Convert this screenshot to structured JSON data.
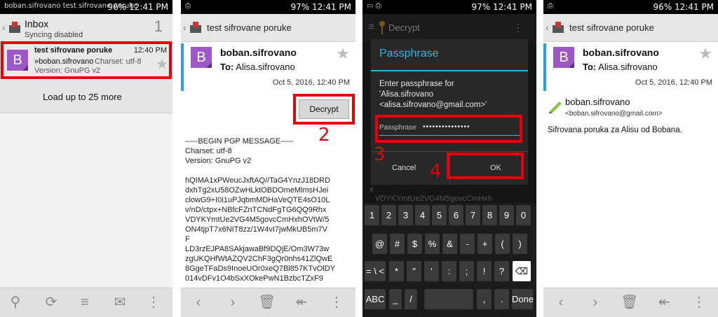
{
  "screen1": {
    "status_left": "boban.sifrovano test sifrovane poruke",
    "status_right": "96% 12:41 PM",
    "title": "Inbox",
    "subtitle": "Syncing disabled",
    "count": "1",
    "mail": {
      "avatar": "B",
      "subject": "test sifrovane poruke",
      "time": "12:40 PM",
      "from": "»boban.sifrovano",
      "snippet1": "Charset: utf-8",
      "snippet2": "Version: GnuPG v2"
    },
    "load_more": "Load up to 25 more",
    "step": "1",
    "bottom_icons": [
      "search-icon",
      "refresh-icon",
      "sort-icon",
      "compose-icon",
      "overflow-icon"
    ]
  },
  "screen2": {
    "status_right": "97% 12:41 PM",
    "title": "test sifrovane poruke",
    "avatar": "B",
    "sender": "boban.sifrovano",
    "to_label": "To:",
    "to_value": "Alisa.sifrovano",
    "date": "Oct 5, 2016, 12:40 PM",
    "decrypt_label": "Decrypt",
    "step": "2",
    "pgp_text": "-----BEGIN PGP MESSAGE-----\nCharset: utf-8\nVersion: GnuPG v2\n\nhQIMA1xPWeucJxftAQ//TaG4YnzJ18DRD\ndxhTg2xU58OZwHLktOBDOmeMlmsHJei\nclowG9+I0i1uPJqbmMDHaVeQTE4sO10L\nv/nD/ctpx+NBfcFZnTCNdFgTG6QQ9Rhx\nVDYKYmtUe2VG4M5govcCmHxhOVtW/5\nON4tjpT7x6NIT8zz/1W4vI7jwMkUB5m7V\nF\nLD3rzEJPA8SAkjawaBf9DQjE/Om3W73w\nzgUKQHfWtAZQV2ChF3gQr0nhs41ZlQwE\n8GgeTFaDs9InoeUOr0xeQ7Bl857KTvOlDY\n014vDFv1O4bSxXOkePwN1BzbcTZxF9"
  },
  "screen3": {
    "status_right": "97% 12:41 PM",
    "appbar_title": "Decrypt",
    "dialog_title": "Passphrase",
    "dialog_body1": "Enter passphrase for",
    "dialog_body2": "'Alisa.sifrovano",
    "dialog_body3": "<alisa.sifrovano@gmail.com>'",
    "field_label": "Passphrase",
    "field_value": "•••••••••••••••",
    "cancel_label": "Cancel",
    "ok_label": "OK",
    "step3": "3",
    "step4": "4",
    "keys_row1": [
      "1",
      "2",
      "3",
      "4",
      "5",
      "6",
      "7",
      "8",
      "9",
      "0"
    ],
    "keys_row2": [
      "@",
      "#",
      "$",
      "%",
      "&",
      "-",
      "+",
      "(",
      ")"
    ],
    "keys_row3": [
      "= \\ <",
      "*",
      "\"",
      "'",
      ":",
      ";",
      "!",
      "?",
      "⌫"
    ],
    "keys_row4": [
      "ABC",
      "_",
      "/",
      " ",
      ",",
      ".",
      "Done"
    ]
  },
  "screen4": {
    "status_right": "96% 12:41 PM",
    "title": "test sifrovane poruke",
    "avatar": "B",
    "sender": "boban.sifrovano",
    "to_label": "To:",
    "to_value": "Alisa.sifrovano",
    "date": "Oct 5, 2016, 12:40 PM",
    "signer": "boban.sifrovano",
    "signer_email": "<boban.sifrovano@gmail.com>",
    "body": "Sifrovana poruka za Alisu od Bobana."
  },
  "colors": {
    "accent_blue": "#33b5e5",
    "avatar_purple": "#9c59c6",
    "highlight_red": "#e8000a"
  }
}
